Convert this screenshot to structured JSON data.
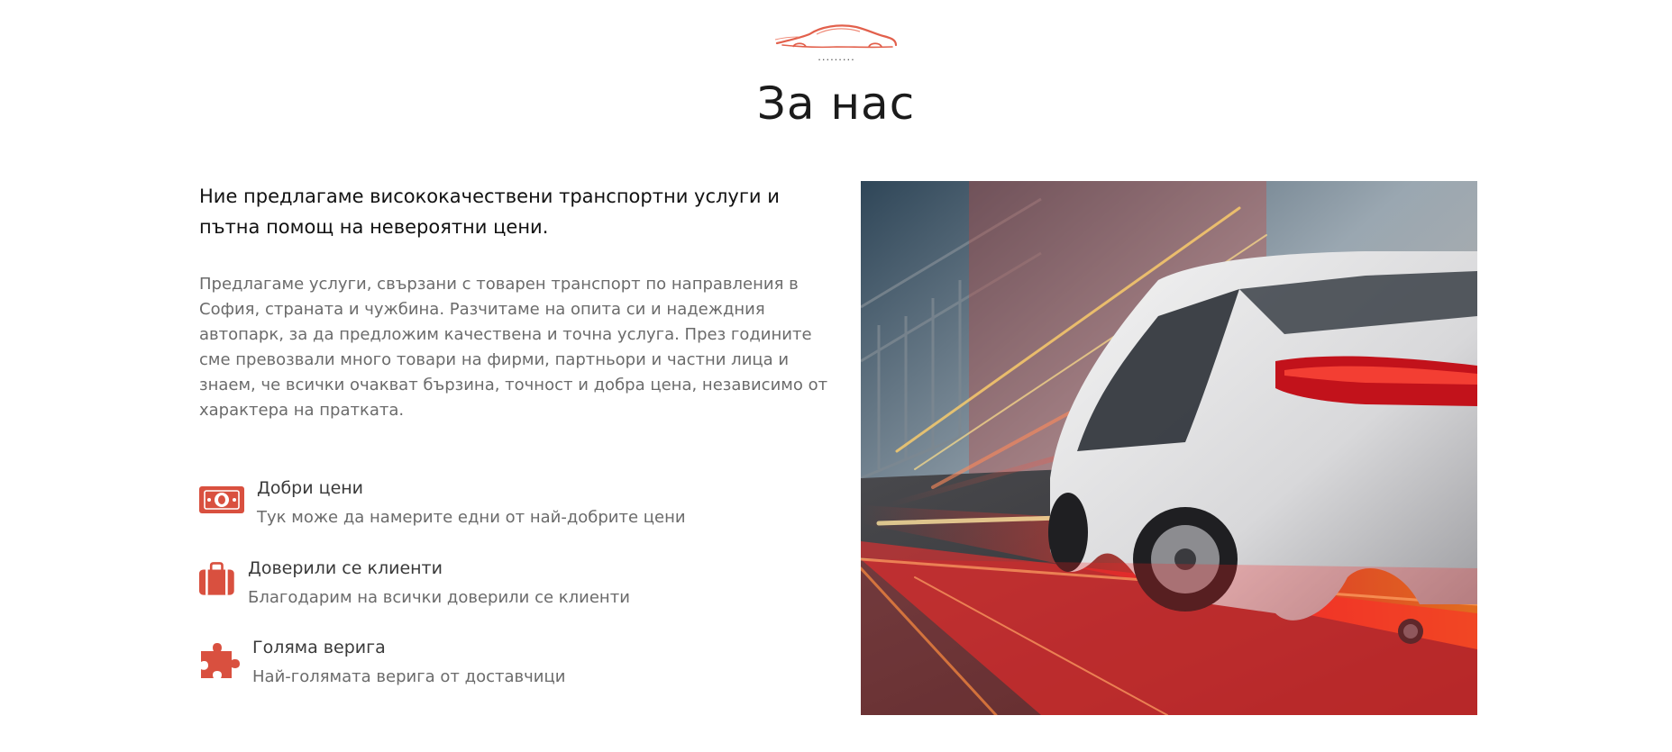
{
  "header": {
    "logo_icon": "car-silhouette-icon",
    "dots": ".........",
    "title": "За нас"
  },
  "intro": {
    "heading": "Ние предлагаме висококачествени транспортни услуги и пътна помощ на невероятни цени.",
    "text": "Предлагаме услуги, свързани с товарен транспорт по направления в София, страната и чужбина. Разчитаме на опита си и надеждния автопарк, за да предложим качествена и точна услуга. През годините сме превозвали много товари на фирми, партньори и частни лица и знаем, че всички очакват бързина, точност и добра цена, независимо от характера на пратката."
  },
  "features": [
    {
      "icon": "money-bill-icon",
      "title": "Добри цени",
      "description": "Тук може да намерите едни от най-добрите цени"
    },
    {
      "icon": "briefcase-icon",
      "title": "Доверили се клиенти",
      "description": "Благодарим на всички доверили се клиенти"
    },
    {
      "icon": "puzzle-piece-icon",
      "title": "Голяма верига",
      "description": "Най-голямата верига от доставчици"
    }
  ],
  "image": {
    "subject": "white-car-speeding-on-bridge"
  },
  "colors": {
    "accent": "#d9503f",
    "title": "#1b1b1b",
    "body_text": "#6b6b6b"
  }
}
